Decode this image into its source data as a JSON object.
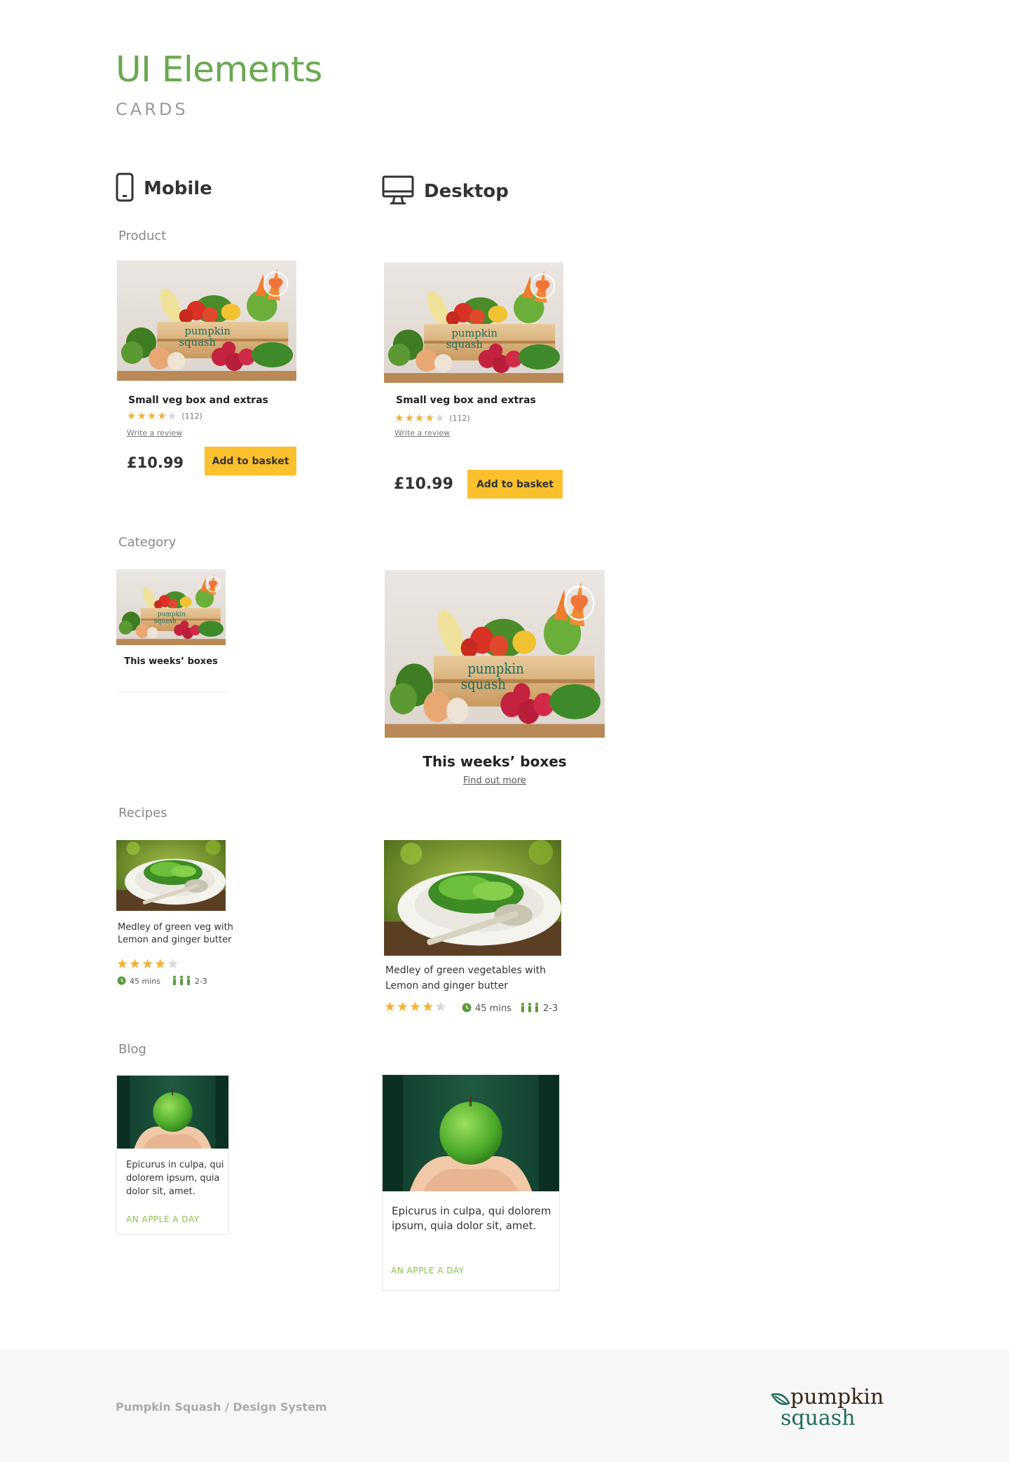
{
  "header": {
    "title": "UI Elements",
    "subtitle": "CARDS"
  },
  "columns": {
    "mobile": "Mobile",
    "desktop": "Desktop",
    "mobile_icon": "mobile-phone-icon",
    "desktop_icon": "desktop-monitor-icon"
  },
  "sections": {
    "product": "Product",
    "category": "Category",
    "recipes": "Recipes",
    "blog": "Blog"
  },
  "product": {
    "title": "Small veg box and extras",
    "rating": 4,
    "rating_max": 5,
    "review_count": "(112)",
    "write_review": "Write a review",
    "price": "£10.99",
    "button": "Add to basket",
    "brand_lines": [
      "pumpkin",
      "squash"
    ]
  },
  "category": {
    "title": "This weeks’ boxes",
    "link": "Find out more"
  },
  "recipe": {
    "title_mobile_l1": "Medley of green veg with",
    "title_mobile_l2": "Lemon and ginger butter",
    "title_desktop_l1": "Medley of green vegetables with",
    "title_desktop_l2": "Lemon and ginger butter",
    "rating": 4,
    "time": "45 mins",
    "serves": "2-3"
  },
  "blog": {
    "text_mobile_l1": "Epicurus in culpa, qui",
    "text_mobile_l2": "dolorem ipsum, quia",
    "text_mobile_l3": "dolor sit, amet.",
    "text_desktop_l1": "Epicurus in culpa, qui dolorem",
    "text_desktop_l2": "ipsum, quia dolor sit, amet.",
    "tag": "AN APPLE A DAY"
  },
  "footer": {
    "text": "Pumpkin Squash / Design System",
    "logo_l1": "pumpkin",
    "logo_l2": "squash"
  },
  "colors": {
    "accent_green": "#6aa84f",
    "button_yellow": "#fbc02d",
    "star": "#f5b031",
    "tag_green": "#8bc34a",
    "brand_teal": "#1e6b5c"
  }
}
